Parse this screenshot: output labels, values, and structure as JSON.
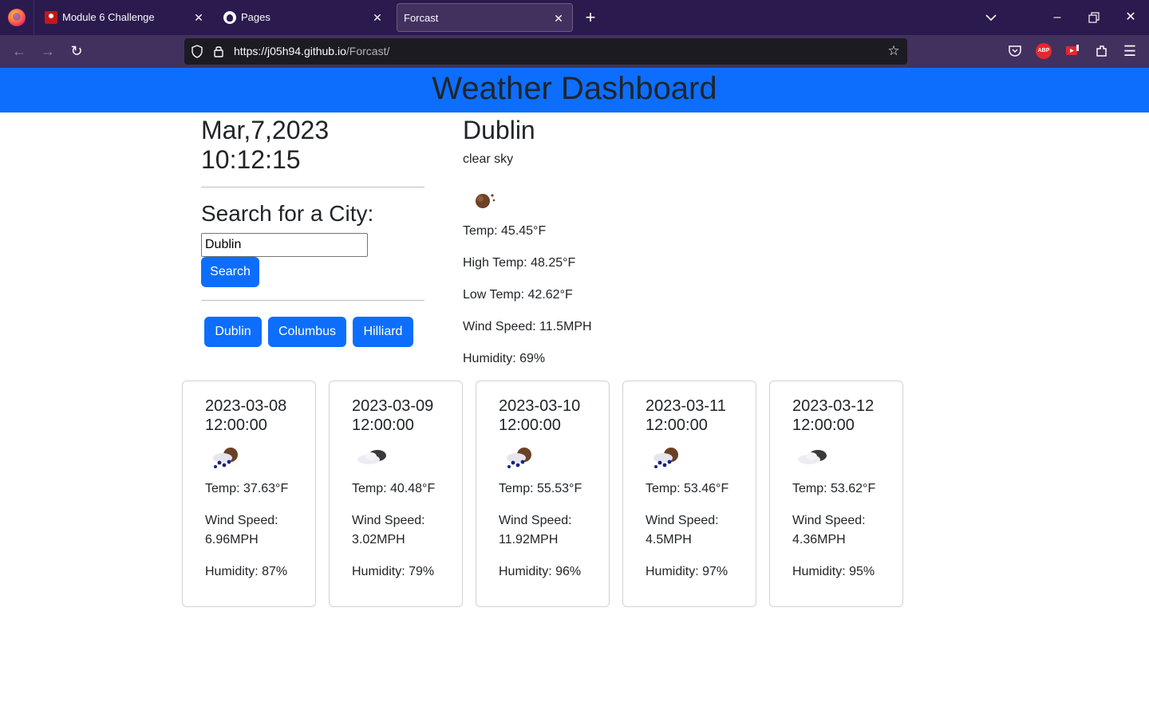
{
  "browser": {
    "tabs": [
      {
        "title": "Module 6 Challenge",
        "favicon": "red-site-icon"
      },
      {
        "title": "Pages",
        "favicon": "github-icon"
      },
      {
        "title": "Forcast",
        "favicon": "none",
        "active": true
      }
    ],
    "url_host": "https://j05h94.github.io",
    "url_path": "/Forcast/"
  },
  "header": {
    "title": "Weather Dashboard"
  },
  "sidebar": {
    "date": "Mar,7,2023",
    "time": "10:12:15",
    "search_heading": "Search for a City:",
    "search_value": "Dublin",
    "search_button": "Search",
    "history": [
      "Dublin",
      "Columbus",
      "Hilliard"
    ]
  },
  "current": {
    "city": "Dublin",
    "description": "clear sky",
    "icon": "clear-sky-icon",
    "temp": "Temp: 45.45°F",
    "high": "High Temp: 48.25°F",
    "low": "Low Temp: 42.62°F",
    "wind": "Wind Speed: 11.5MPH",
    "humidity": "Humidity: 69%"
  },
  "forecast": [
    {
      "date": "2023-03-08",
      "time": "12:00:00",
      "icon": "rain-icon",
      "temp": "Temp: 37.63°F",
      "wind_label": "Wind Speed:",
      "wind_value": "6.96MPH",
      "humidity": "Humidity: 87%"
    },
    {
      "date": "2023-03-09",
      "time": "12:00:00",
      "icon": "cloud-icon",
      "temp": "Temp: 40.48°F",
      "wind_label": "Wind Speed:",
      "wind_value": "3.02MPH",
      "humidity": "Humidity: 79%"
    },
    {
      "date": "2023-03-10",
      "time": "12:00:00",
      "icon": "rain-icon",
      "temp": "Temp: 55.53°F",
      "wind_label": "Wind Speed:",
      "wind_value": "11.92MPH",
      "humidity": "Humidity: 96%"
    },
    {
      "date": "2023-03-11",
      "time": "12:00:00",
      "icon": "rain-icon",
      "temp": "Temp: 53.46°F",
      "wind_label": "Wind Speed:",
      "wind_value": "4.5MPH",
      "humidity": "Humidity: 97%"
    },
    {
      "date": "2023-03-12",
      "time": "12:00:00",
      "icon": "cloud-icon",
      "temp": "Temp: 53.62°F",
      "wind_label": "Wind Speed:",
      "wind_value": "4.36MPH",
      "humidity": "Humidity: 95%"
    }
  ],
  "colors": {
    "header": "#0d6efd",
    "button": "#0d6efd",
    "tabbar": "#2b1a4d",
    "navbar": "#42305e"
  }
}
